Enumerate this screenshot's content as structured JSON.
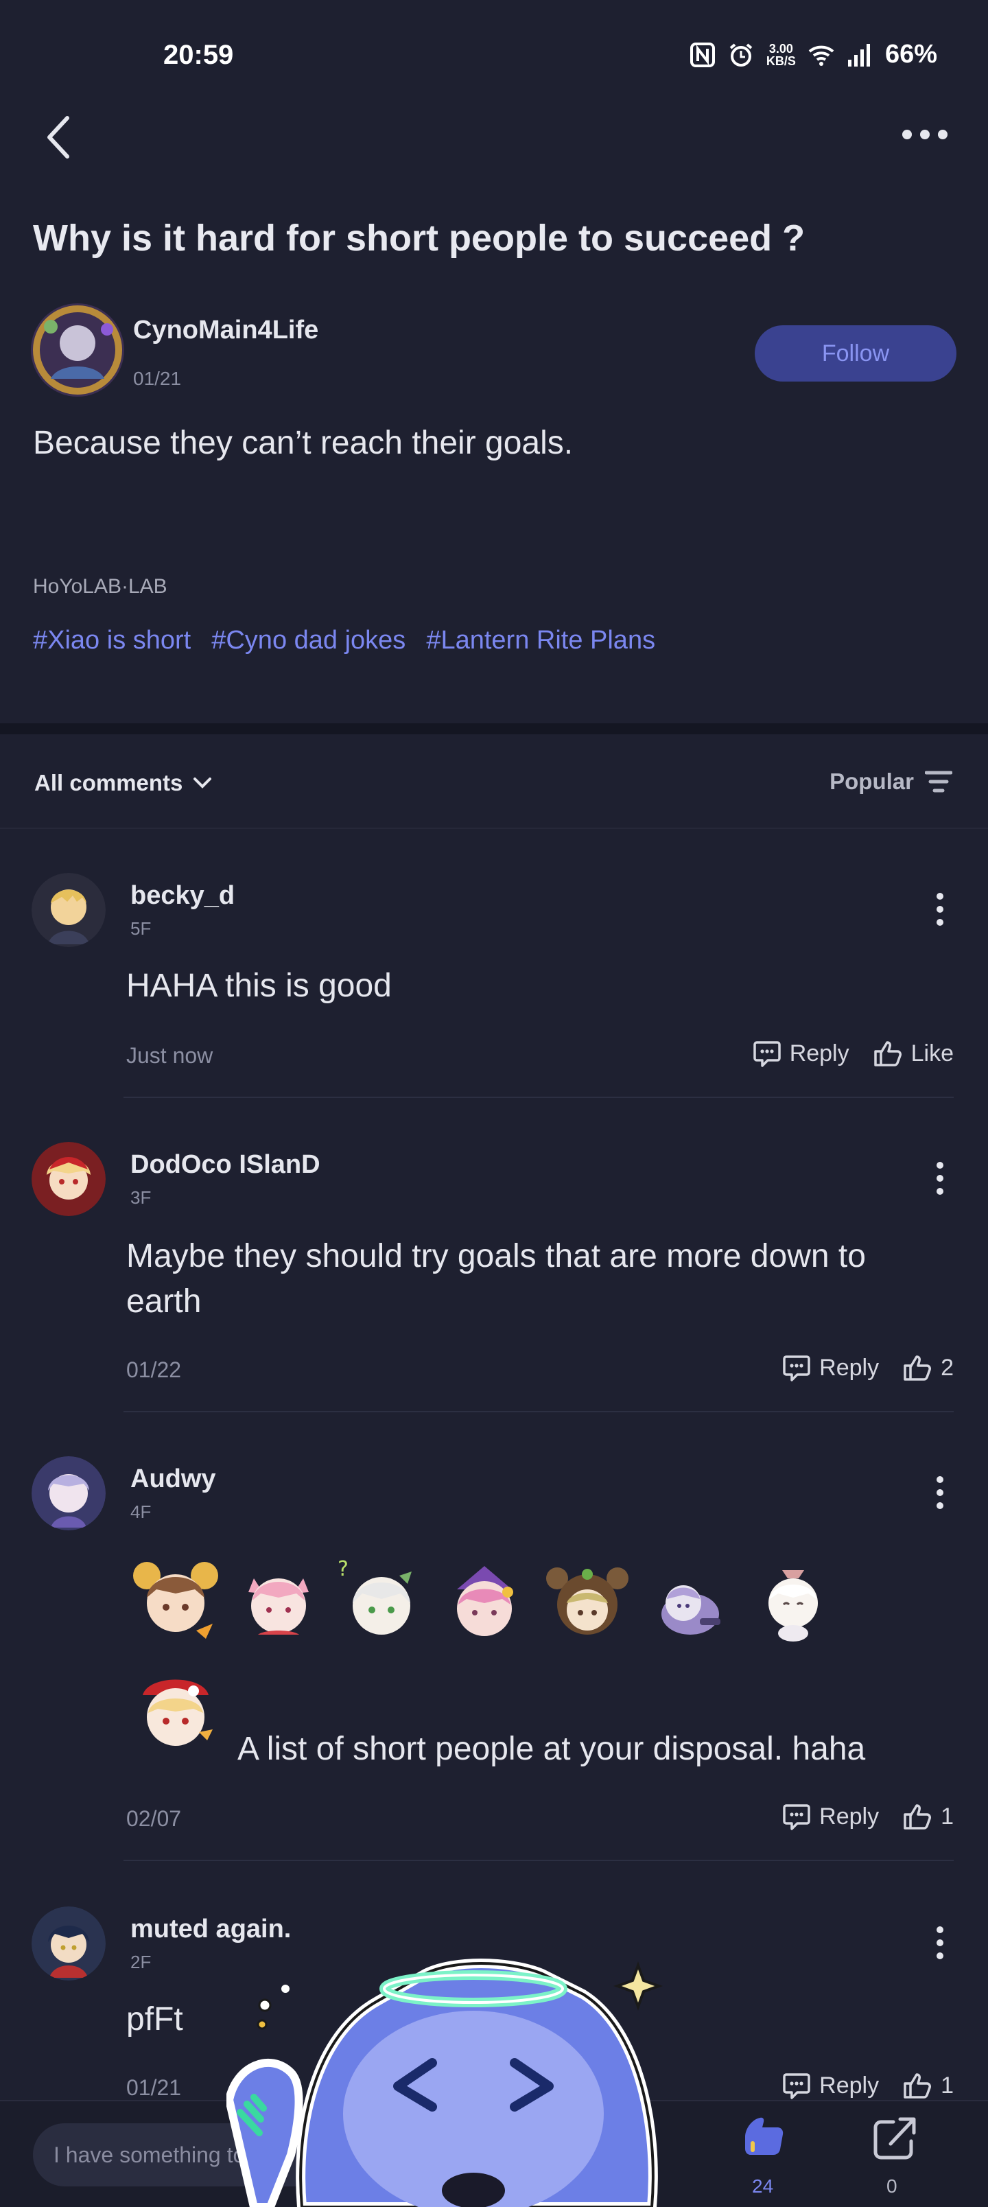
{
  "status_bar": {
    "time": "20:59",
    "speed_top": "3.00",
    "speed_bottom": "KB/S",
    "battery": "66%"
  },
  "post": {
    "title": "Why is it hard for short people to succeed ?",
    "author": "CynoMain4Life",
    "date": "01/21",
    "follow_label": "Follow",
    "body": "Because they can’t reach their goals.",
    "source": "HoYoLAB·LAB",
    "tags": [
      "#Xiao is short",
      "#Cyno dad jokes",
      "#Lantern Rite Plans"
    ]
  },
  "comments_header": {
    "label": "All comments",
    "sort": "Popular"
  },
  "comments": [
    {
      "name": "becky_d",
      "floor": "5F",
      "text": "HAHA this is good",
      "date": "Just now",
      "reply": "Reply",
      "like": "Like"
    },
    {
      "name": "DodOco ISlanD",
      "floor": "3F",
      "text_line1": "Maybe they should try goals that are more down to",
      "text_line2": "earth",
      "date": "01/22",
      "reply": "Reply",
      "like": "2"
    },
    {
      "name": "Audwy",
      "floor": "4F",
      "text": "A list of short people at your disposal. haha",
      "date": "02/07",
      "reply": "Reply",
      "like": "1"
    },
    {
      "name": "muted again.",
      "floor": "2F",
      "text": "pfFt",
      "date": "01/21",
      "reply": "Reply",
      "like": "1"
    }
  ],
  "bottom_bar": {
    "placeholder": "I have something to s",
    "like_count": "24",
    "share_count": "0"
  },
  "colors": {
    "background": "#1e2030",
    "accent": "#7b87f0",
    "follow_bg": "#3a4290"
  }
}
